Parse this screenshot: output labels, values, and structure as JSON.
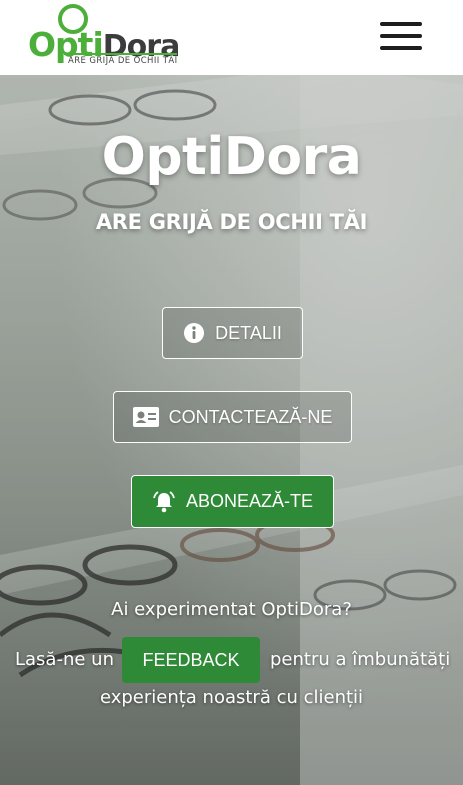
{
  "header": {
    "logo": {
      "word_opti": "Opti",
      "word_dora": "Dora",
      "tagline": "ARE GRIJĂ DE OCHII TĂI",
      "brand_color": "#4caf3a"
    },
    "menu_icon": "hamburger-menu-icon"
  },
  "hero": {
    "title": "OptiDora",
    "subtitle": "ARE GRIJĂ DE OCHII TĂI",
    "buttons": {
      "details": {
        "label": "DETALII",
        "icon": "info-icon"
      },
      "contact": {
        "label": "CONTACTEAZĂ-NE",
        "icon": "contact-card-icon"
      },
      "subscribe": {
        "label": "ABONEAZĂ-TE",
        "icon": "bell-icon",
        "color": "#2e8a37"
      }
    },
    "feedback": {
      "question": "Ai experimentat OptiDora?",
      "prefix": "Lasă-ne un",
      "button_label": "FEEDBACK",
      "suffix": "pentru a îmbunătăți",
      "ending": "experiența noastră cu clienții"
    }
  }
}
